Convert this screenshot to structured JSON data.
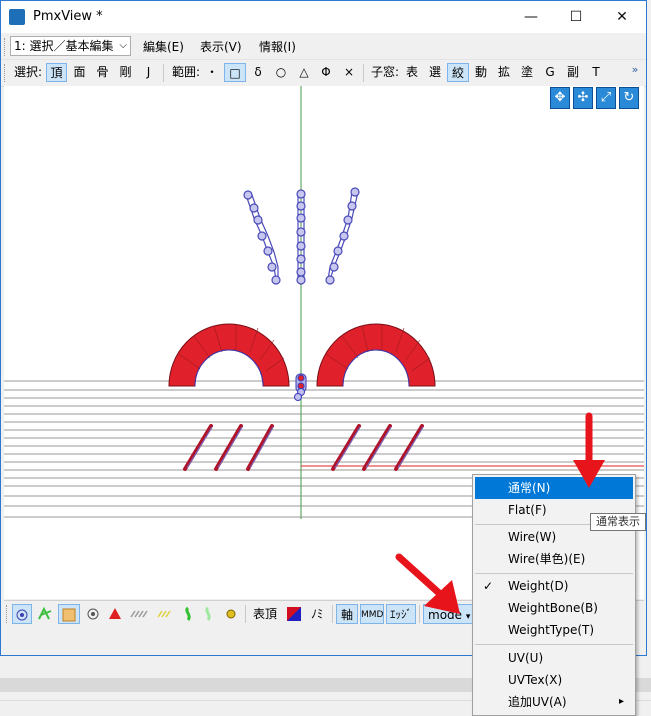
{
  "window": {
    "title": "PmxView *",
    "min_glyph": "—",
    "max_glyph": "☐",
    "close_glyph": "✕"
  },
  "menubar": {
    "mode": "1: 選択／基本編集",
    "items": [
      "編集(E)",
      "表示(V)",
      "情報(I)"
    ]
  },
  "toolbar": {
    "select_label": "選択:",
    "select_items": [
      "頂",
      "面",
      "骨",
      "剛",
      "J"
    ],
    "range_label": "範囲:",
    "range_items": [
      "・",
      "□",
      "δ",
      "○",
      "△",
      "Φ",
      "×"
    ],
    "child_label": "子窓:",
    "child_items": [
      "表",
      "選",
      "絞",
      "動",
      "拡",
      "塗",
      "G",
      "副",
      "T"
    ],
    "overflow": "»"
  },
  "viewport": {
    "nav_icons": [
      "move-xy-icon",
      "move-all-icon",
      "zoom-icon",
      "rotate-icon"
    ]
  },
  "bottombar": {
    "text_vertex": "表頂",
    "nomi": "ﾉﾐ",
    "axis": "軸",
    "mmd": "MMD",
    "edge": "ｴｯｼﾞ",
    "mode": "mode",
    "mode_arrow": "▾"
  },
  "context_menu": {
    "items": [
      {
        "label": "通常(N)",
        "highlighted": true
      },
      {
        "label": "Flat(F)"
      },
      {
        "label": "Wire(W)"
      },
      {
        "label": "Wire(単色)(E)"
      },
      {
        "label": "Weight(D)",
        "checked": true
      },
      {
        "label": "WeightBone(B)"
      },
      {
        "label": "WeightType(T)"
      },
      {
        "label": "UV(U)"
      },
      {
        "label": "UVTex(X)"
      },
      {
        "label": "追加UV(A)",
        "submenu": true
      }
    ],
    "check_glyph": "✓",
    "submenu_glyph": "▸",
    "tooltip": "通常表示"
  },
  "colors": {
    "accent": "#0078d7",
    "mesh_red": "#e0202a",
    "arrow_red": "#e8141b",
    "bone_blue": "#3a3ab8"
  }
}
